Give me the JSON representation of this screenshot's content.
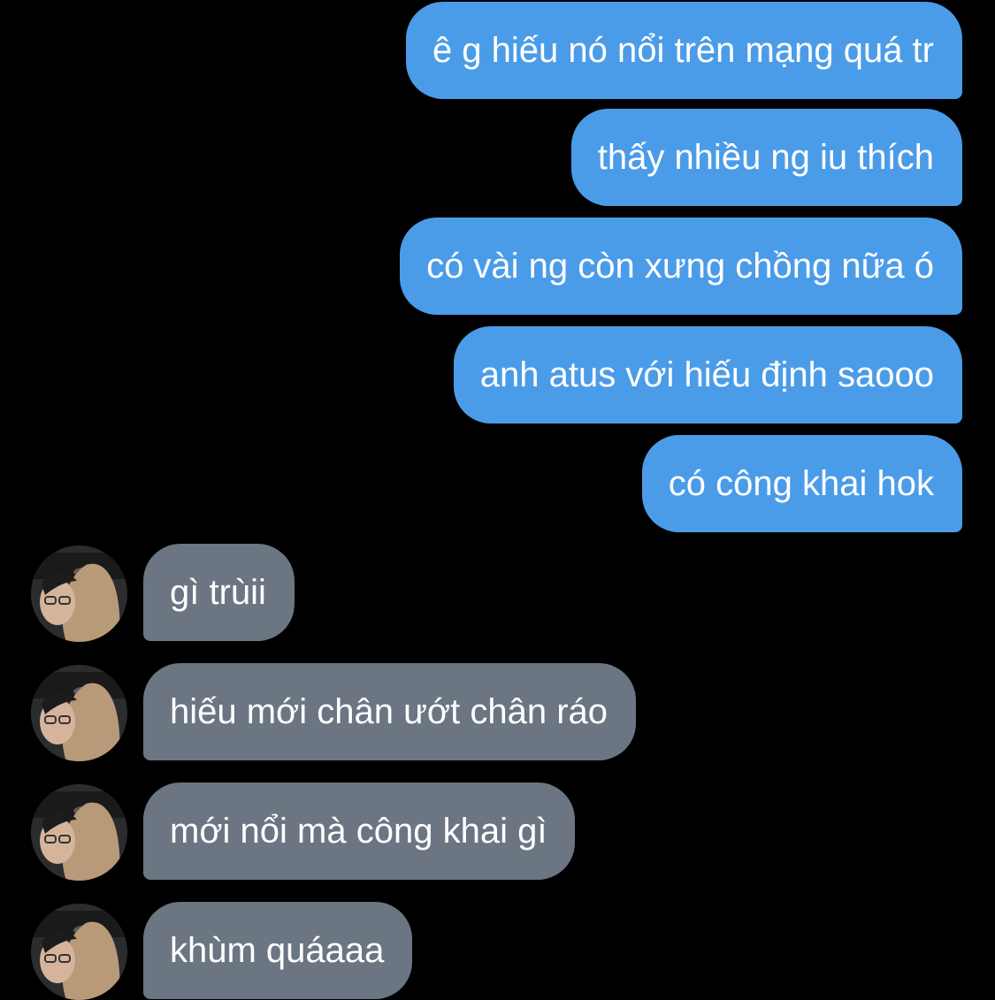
{
  "conversation": {
    "sent": [
      {
        "text": "ê g hiếu nó nổi trên mạng quá tr"
      },
      {
        "text": "thấy nhiều ng iu thích"
      },
      {
        "text": "có vài ng còn xưng chồng nữa ó"
      },
      {
        "text": "anh atus với hiếu định saooo"
      },
      {
        "text": "có công khai hok"
      }
    ],
    "received": [
      {
        "text": "gì trùii"
      },
      {
        "text": "hiếu mới chân ướt chân ráo"
      },
      {
        "text": "mới nổi mà công khai gì"
      },
      {
        "text": "khùm quáaaa"
      }
    ]
  },
  "colors": {
    "background": "#000000",
    "sent_bubble": "#4b9ce8",
    "received_bubble": "#6b7682",
    "text": "#ffffff"
  },
  "avatar_icon": "person-in-hoodie-avatar"
}
